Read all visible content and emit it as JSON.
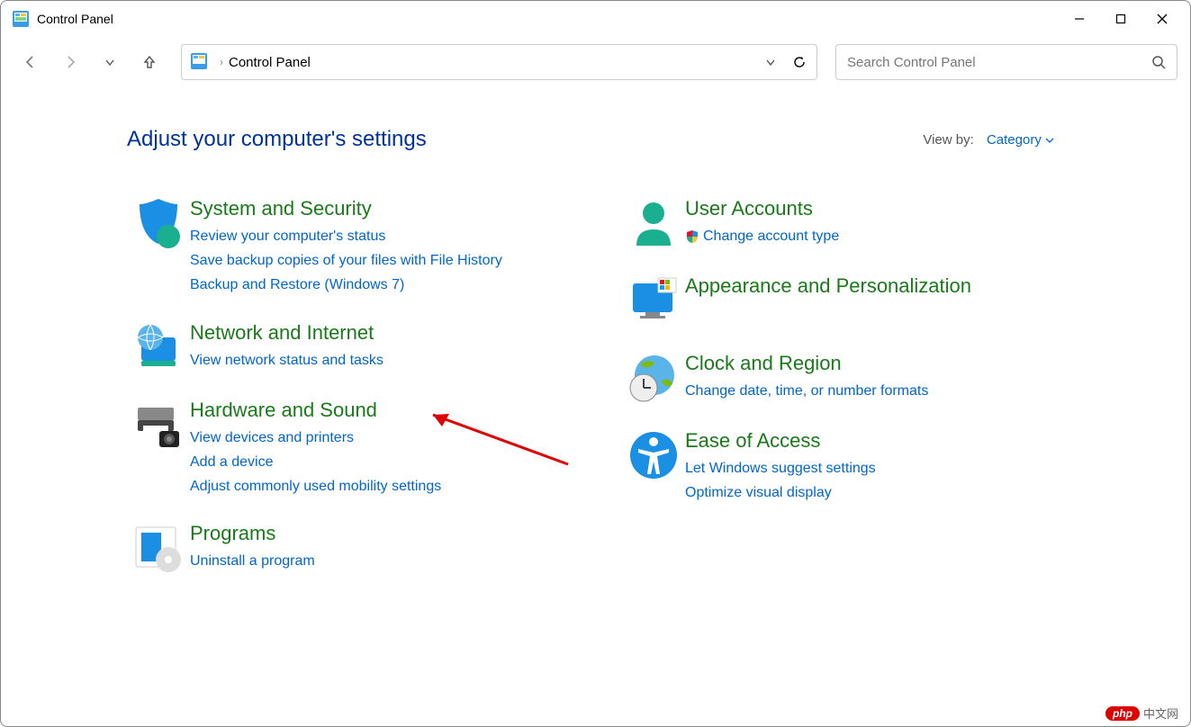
{
  "window": {
    "title": "Control Panel"
  },
  "address": {
    "location": "Control Panel"
  },
  "search": {
    "placeholder": "Search Control Panel"
  },
  "heading": "Adjust your computer's settings",
  "viewby": {
    "label": "View by:",
    "value": "Category"
  },
  "left_col": [
    {
      "title": "System and Security",
      "links": [
        "Review your computer's status",
        "Save backup copies of your files with File History",
        "Backup and Restore (Windows 7)"
      ]
    },
    {
      "title": "Network and Internet",
      "links": [
        "View network status and tasks"
      ]
    },
    {
      "title": "Hardware and Sound",
      "links": [
        "View devices and printers",
        "Add a device",
        "Adjust commonly used mobility settings"
      ]
    },
    {
      "title": "Programs",
      "links": [
        "Uninstall a program"
      ]
    }
  ],
  "right_col": [
    {
      "title": "User Accounts",
      "links": [
        "Change account type"
      ],
      "shield": true
    },
    {
      "title": "Appearance and Personalization",
      "links": []
    },
    {
      "title": "Clock and Region",
      "links": [
        "Change date, time, or number formats"
      ]
    },
    {
      "title": "Ease of Access",
      "links": [
        "Let Windows suggest settings",
        "Optimize visual display"
      ]
    }
  ],
  "watermark": {
    "brand": "php",
    "text": "中文网"
  }
}
